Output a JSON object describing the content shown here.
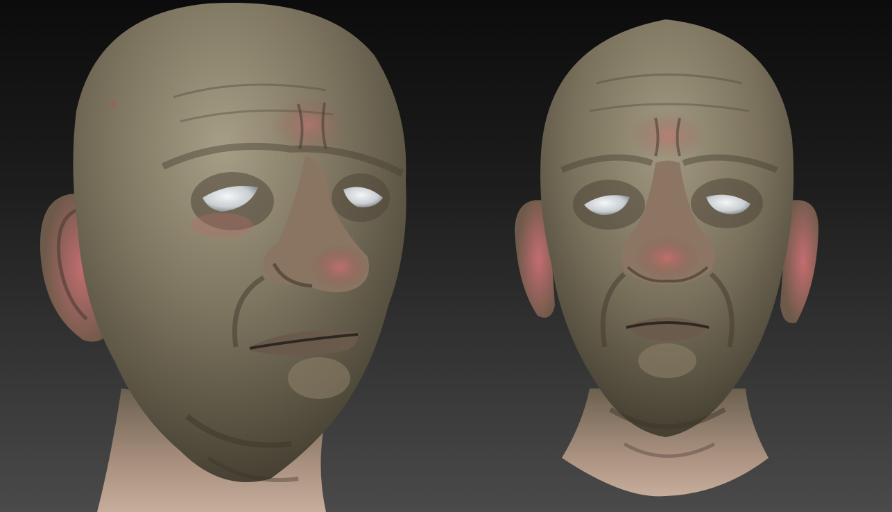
{
  "scene": {
    "background_top": "#0c0c0c",
    "background_bottom": "#4a4a4a",
    "skin_color": "#7e7560",
    "skin_highlight": "#a79e86",
    "skin_shadow": "#3f3a2d",
    "flush_color": "#b86a68",
    "neck_color": "#b8a08e",
    "eye_color": "#d8dcdf"
  },
  "models": [
    {
      "name": "head-three-quarter-view"
    },
    {
      "name": "head-front-view"
    }
  ]
}
